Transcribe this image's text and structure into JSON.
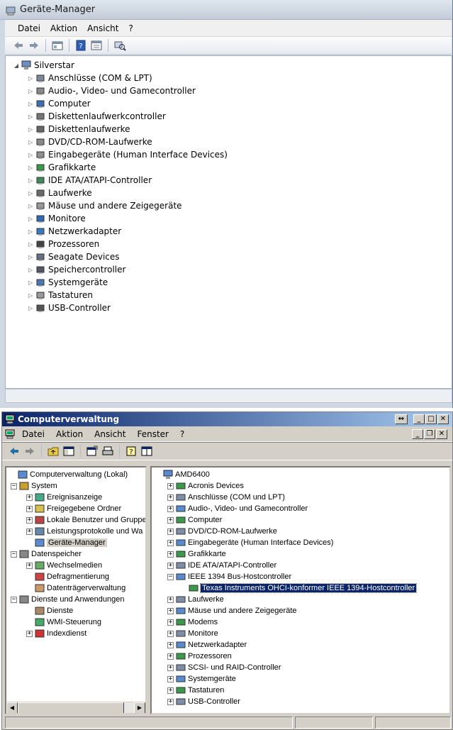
{
  "win1": {
    "title": "Geräte-Manager",
    "menu": [
      "Datei",
      "Aktion",
      "Ansicht",
      "?"
    ],
    "root": "Silverstar",
    "items": [
      {
        "label": "Anschlüsse (COM & LPT)",
        "icon": "port-icon"
      },
      {
        "label": "Audio-, Video- und Gamecontroller",
        "icon": "speaker-icon"
      },
      {
        "label": "Computer",
        "icon": "computer-icon"
      },
      {
        "label": "Diskettenlaufwerkcontroller",
        "icon": "floppy-controller-icon"
      },
      {
        "label": "Diskettenlaufwerke",
        "icon": "floppy-drive-icon"
      },
      {
        "label": "DVD/CD-ROM-Laufwerke",
        "icon": "dvd-drive-icon"
      },
      {
        "label": "Eingabegeräte (Human Interface Devices)",
        "icon": "hid-icon"
      },
      {
        "label": "Grafikkarte",
        "icon": "display-adapter-icon"
      },
      {
        "label": "IDE ATA/ATAPI-Controller",
        "icon": "ide-controller-icon"
      },
      {
        "label": "Laufwerke",
        "icon": "disk-drive-icon"
      },
      {
        "label": "Mäuse und andere Zeigegeräte",
        "icon": "mouse-icon"
      },
      {
        "label": "Monitore",
        "icon": "monitor-icon"
      },
      {
        "label": "Netzwerkadapter",
        "icon": "network-adapter-icon"
      },
      {
        "label": "Prozessoren",
        "icon": "processor-icon"
      },
      {
        "label": "Seagate Devices",
        "icon": "device-icon"
      },
      {
        "label": "Speichercontroller",
        "icon": "storage-controller-icon"
      },
      {
        "label": "Systemgeräte",
        "icon": "system-device-icon"
      },
      {
        "label": "Tastaturen",
        "icon": "keyboard-icon"
      },
      {
        "label": "USB-Controller",
        "icon": "usb-icon"
      }
    ]
  },
  "win2": {
    "title": "Computerverwaltung",
    "menu": [
      "Datei",
      "Aktion",
      "Ansicht",
      "Fenster",
      "?"
    ],
    "left_tree": [
      {
        "label": "Computerverwaltung (Lokal)",
        "level": 0,
        "expander": ""
      },
      {
        "label": "System",
        "level": 1,
        "expander": "−"
      },
      {
        "label": "Ereignisanzeige",
        "level": 2,
        "expander": "+"
      },
      {
        "label": "Freigegebene Ordner",
        "level": 2,
        "expander": "+"
      },
      {
        "label": "Lokale Benutzer und Gruppe",
        "level": 2,
        "expander": "+"
      },
      {
        "label": "Leistungsprotokolle und Wa",
        "level": 2,
        "expander": "+"
      },
      {
        "label": "Geräte-Manager",
        "level": 2,
        "expander": "",
        "selected": true
      },
      {
        "label": "Datenspeicher",
        "level": 1,
        "expander": "−"
      },
      {
        "label": "Wechselmedien",
        "level": 2,
        "expander": "+"
      },
      {
        "label": "Defragmentierung",
        "level": 2,
        "expander": ""
      },
      {
        "label": "Datenträgerverwaltung",
        "level": 2,
        "expander": ""
      },
      {
        "label": "Dienste und Anwendungen",
        "level": 1,
        "expander": "−"
      },
      {
        "label": "Dienste",
        "level": 2,
        "expander": ""
      },
      {
        "label": "WMI-Steuerung",
        "level": 2,
        "expander": ""
      },
      {
        "label": "Indexdienst",
        "level": 2,
        "expander": "+"
      }
    ],
    "right_root": "AMD6400",
    "right_items": [
      {
        "label": "Acronis Devices",
        "expander": "+"
      },
      {
        "label": "Anschlüsse (COM und LPT)",
        "expander": "+"
      },
      {
        "label": "Audio-, Video- und Gamecontroller",
        "expander": "+"
      },
      {
        "label": "Computer",
        "expander": "+"
      },
      {
        "label": "DVD/CD-ROM-Laufwerke",
        "expander": "+"
      },
      {
        "label": "Eingabegeräte (Human Interface Devices)",
        "expander": "+"
      },
      {
        "label": "Grafikkarte",
        "expander": "+"
      },
      {
        "label": "IDE ATA/ATAPI-Controller",
        "expander": "+"
      },
      {
        "label": "IEEE 1394 Bus-Hostcontroller",
        "expander": "−"
      },
      {
        "label": "Texas Instruments OHCI-konformer IEEE 1394-Hostcontroller",
        "expander": "",
        "child": true,
        "selected": true
      },
      {
        "label": "Laufwerke",
        "expander": "+"
      },
      {
        "label": "Mäuse und andere Zeigegeräte",
        "expander": "+"
      },
      {
        "label": "Modems",
        "expander": "+"
      },
      {
        "label": "Monitore",
        "expander": "+"
      },
      {
        "label": "Netzwerkadapter",
        "expander": "+"
      },
      {
        "label": "Prozessoren",
        "expander": "+"
      },
      {
        "label": "SCSI- und RAID-Controller",
        "expander": "+"
      },
      {
        "label": "Systemgeräte",
        "expander": "+"
      },
      {
        "label": "Tastaturen",
        "expander": "+"
      },
      {
        "label": "USB-Controller",
        "expander": "+"
      }
    ]
  },
  "colors": {
    "selection": "#0a246a",
    "titlebar_start": "#0a246a",
    "titlebar_end": "#a6caf0"
  }
}
